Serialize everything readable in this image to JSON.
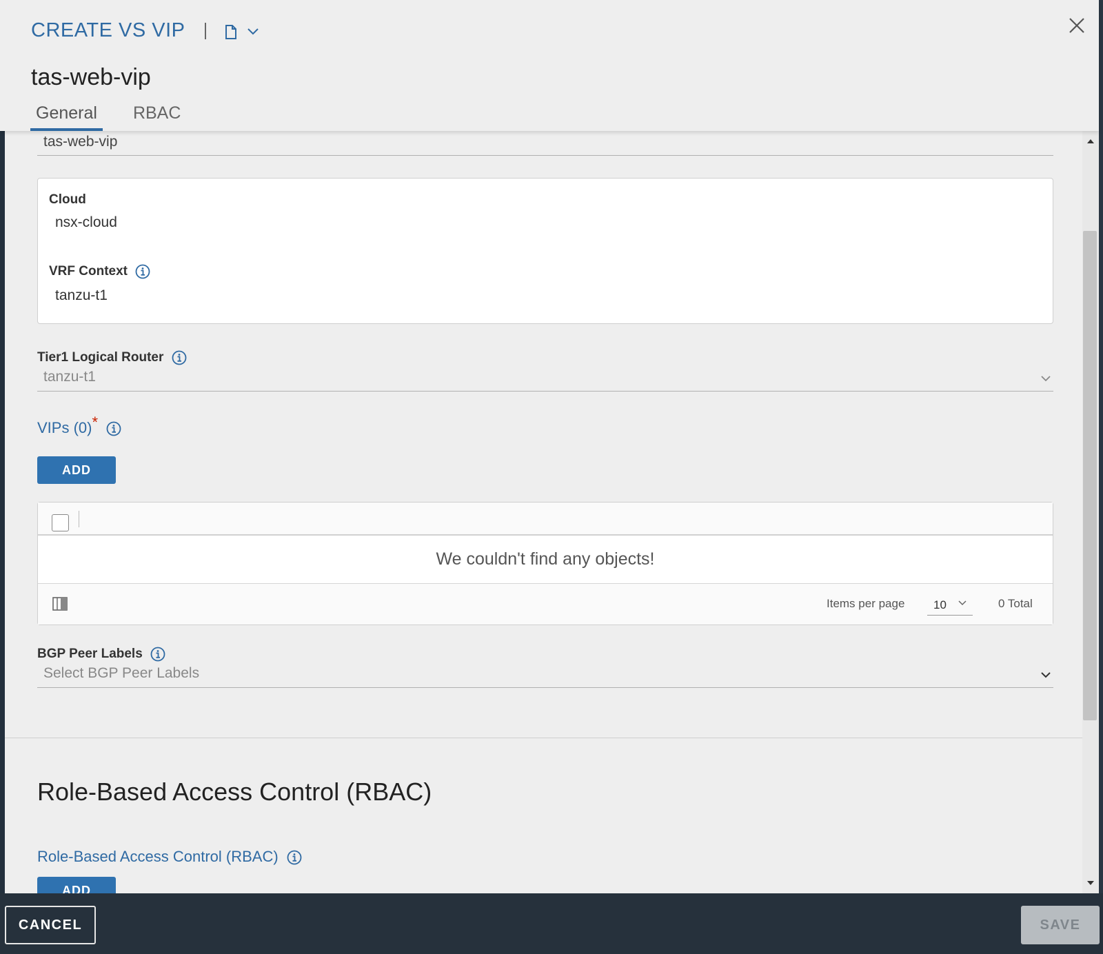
{
  "header": {
    "title": "CREATE VS VIP",
    "object_name": "tas-web-vip",
    "tabs": [
      {
        "label": "General",
        "active": true
      },
      {
        "label": "RBAC",
        "active": false
      }
    ]
  },
  "form": {
    "name_value": "tas-web-vip",
    "cloud": {
      "label": "Cloud",
      "value": "nsx-cloud"
    },
    "vrf_context": {
      "label": "VRF Context",
      "value": "tanzu-t1"
    },
    "tier1_router": {
      "label": "Tier1 Logical Router",
      "value": "tanzu-t1"
    },
    "vips": {
      "label": "VIPs (0)",
      "required_marker": "*",
      "add_label": "ADD",
      "empty_message": "We couldn't find any objects!",
      "items_per_page_label": "Items per page",
      "items_per_page_value": "10",
      "total_label": "0 Total"
    },
    "bgp_peer_labels": {
      "label": "BGP Peer Labels",
      "placeholder": "Select BGP Peer Labels"
    },
    "rbac": {
      "section_title": "Role-Based Access Control (RBAC)",
      "label": "Role-Based Access Control (RBAC)",
      "add_label": "ADD"
    }
  },
  "footer": {
    "cancel_label": "CANCEL",
    "save_label": "SAVE"
  },
  "colors": {
    "accent": "#2f6aa3",
    "primary_button": "#2f72b0",
    "footer_bg": "#26313c",
    "required": "#c92100"
  },
  "icons": [
    "document-icon",
    "chevron-down-icon",
    "close-icon",
    "info-icon",
    "column-toggle-icon",
    "scroll-up-icon",
    "scroll-down-icon"
  ]
}
